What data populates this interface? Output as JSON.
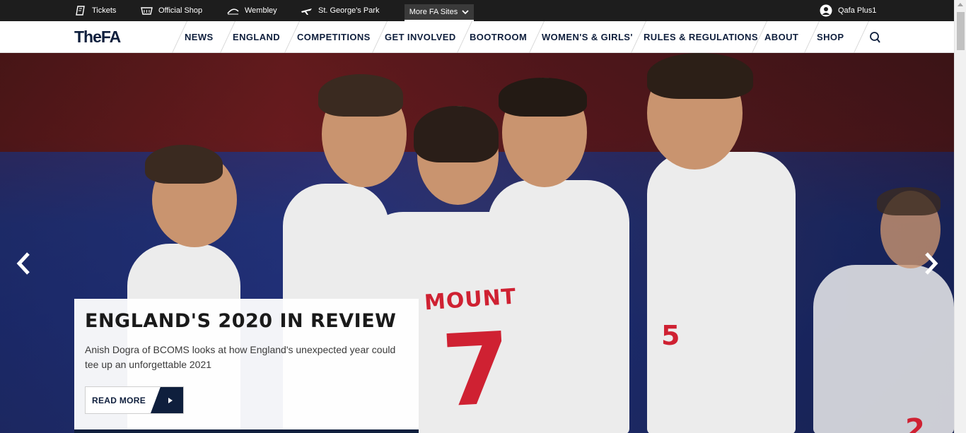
{
  "utility_bar": {
    "items": [
      {
        "label": "Tickets",
        "icon": "ticket-icon"
      },
      {
        "label": "Official Shop",
        "icon": "shopping-basket-icon"
      },
      {
        "label": "Wembley",
        "icon": "wembley-arch-icon"
      },
      {
        "label": "St. George's Park",
        "icon": "plane-icon"
      }
    ],
    "more_sites": {
      "label": "More FA Sites",
      "icon": "chevron-down-icon"
    },
    "account": {
      "label": "Qafa Plus1",
      "icon": "user-avatar-icon"
    }
  },
  "nav": {
    "logo": "TheFA",
    "items": [
      {
        "label": "NEWS"
      },
      {
        "label": "ENGLAND"
      },
      {
        "label": "COMPETITIONS"
      },
      {
        "label": "GET INVOLVED"
      },
      {
        "label": "BOOTROOM"
      },
      {
        "label": "WOMEN'S & GIRLS'"
      },
      {
        "label": "RULES & REGULATIONS"
      },
      {
        "label": "ABOUT"
      },
      {
        "label": "SHOP"
      }
    ],
    "search_icon": "search-icon"
  },
  "hero": {
    "shirt_name": "MOUNT",
    "shirt_number": "7",
    "shirt_number_second": "5",
    "shirt_number_third": "2",
    "prev_icon": "chevron-left-icon",
    "next_icon": "chevron-right-icon"
  },
  "story": {
    "title": "ENGLAND'S 2020 IN REVIEW",
    "summary": "Anish Dogra of BCOMS looks at how England's unexpected year could tee up an unforgettable 2021",
    "cta_label": "READ MORE",
    "cta_icon": "caret-right-icon"
  },
  "colors": {
    "brand_navy": "#0f1f3d",
    "utility_bar": "#1d1d1d",
    "england_red": "#cf2132"
  }
}
